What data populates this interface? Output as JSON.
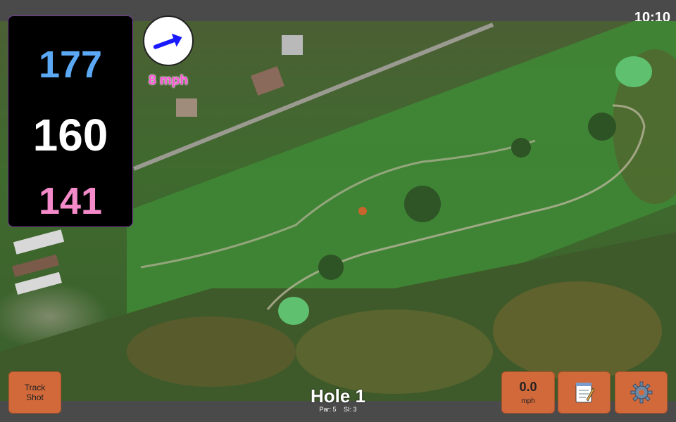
{
  "status_bar": {
    "clock": "10:10"
  },
  "distances": {
    "back": "177",
    "middle": "160",
    "front": "141"
  },
  "wind": {
    "speed_label": "8 mph",
    "icon": "wind-arrow-icon",
    "direction_deg": -20
  },
  "hole": {
    "title": "Hole 1",
    "par_label": "Par: 5",
    "si_label": "SI: 3"
  },
  "buttons": {
    "track_shot_line1": "Track",
    "track_shot_line2": "Shot",
    "speed_value": "0.0",
    "speed_unit": "mph",
    "notes_icon": "notepad-icon",
    "settings_icon": "gear-icon"
  },
  "colors": {
    "back": "#5ba9f5",
    "middle": "#ffffff",
    "front": "#f48ac9",
    "wind": "#ff4fd8",
    "button": "#d2693a"
  }
}
